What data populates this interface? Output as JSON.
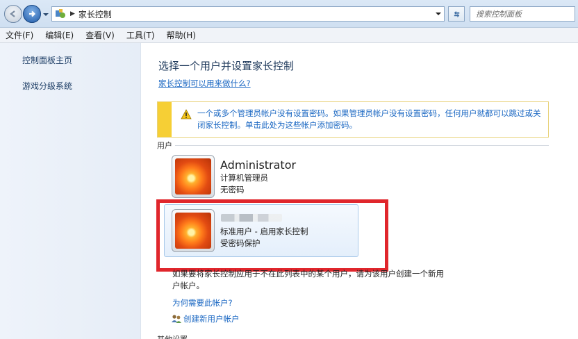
{
  "address_bar": {
    "breadcrumb": "家长控制",
    "search_placeholder": "搜索控制面板"
  },
  "menu": [
    "文件(F)",
    "编辑(E)",
    "查看(V)",
    "工具(T)",
    "帮助(H)"
  ],
  "left_nav": {
    "items": [
      "控制面板主页",
      "游戏分级系统"
    ]
  },
  "main": {
    "title": "选择一个用户并设置家长控制",
    "help_link": "家长控制可以用来做什么?",
    "warning": "一个或多个管理员帐户没有设置密码。如果管理员帐户没有设置密码，任何用户就都可以跳过或关闭家长控制。单击此处为这些帐户添加密码。",
    "users_label": "用户",
    "users": [
      {
        "name": "Administrator",
        "role": "计算机管理员",
        "status": "无密码"
      },
      {
        "name": "",
        "role": "标准用户 - 启用家长控制",
        "status": "受密码保护"
      }
    ],
    "info": "如果要将家长控制应用于不在此列表中的某个用户，请为该用户创建一个新用户帐户。",
    "why_link": "为何需要此帐户?",
    "create_link": "创建新用户帐户",
    "other_label": "其他设置"
  },
  "colors": {
    "highlight_box": "#e0262c",
    "link": "#1866c2",
    "warning_stripe": "#f6cf35"
  }
}
